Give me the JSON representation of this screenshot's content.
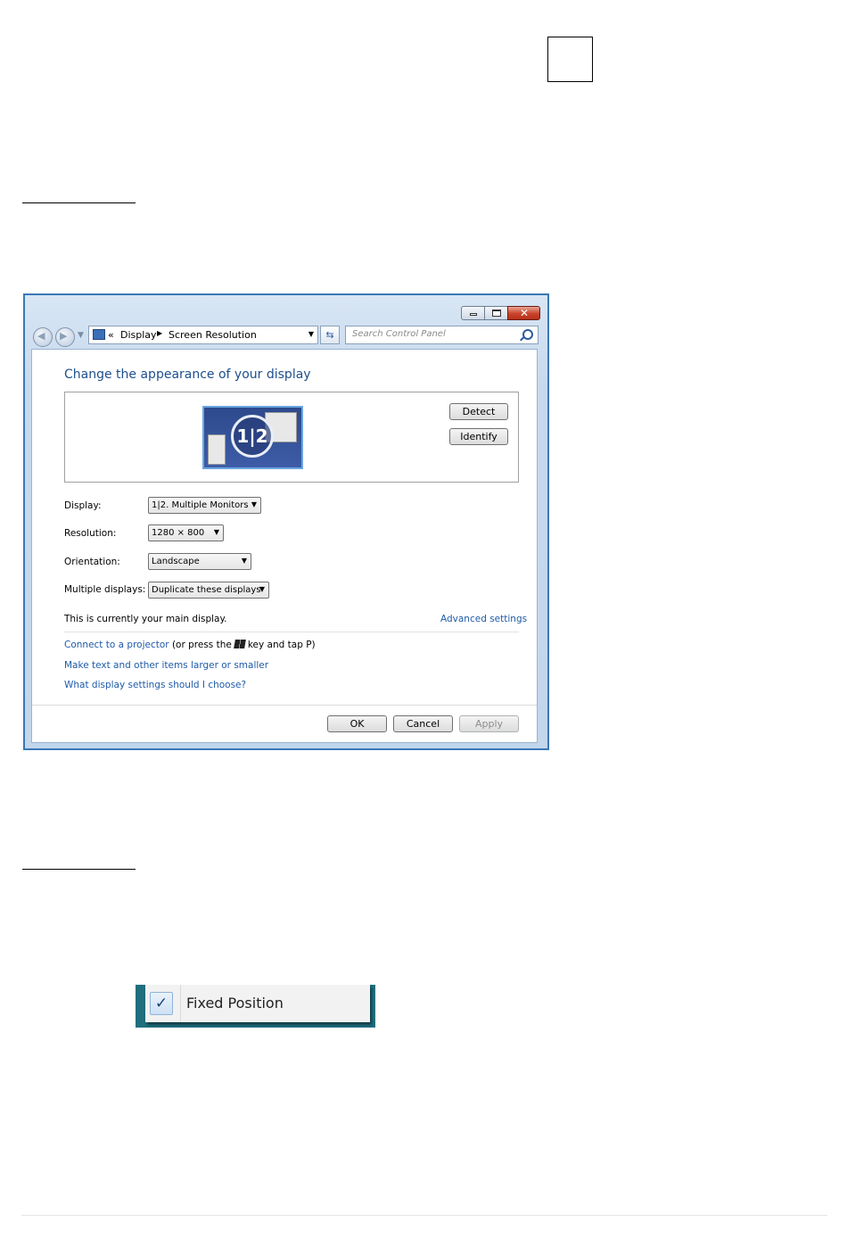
{
  "window": {
    "breadcrumb_prefix": "«",
    "breadcrumb": [
      "Display",
      "Screen Resolution"
    ],
    "search_placeholder": "Search Control Panel",
    "title": "Change the appearance of your display",
    "monitor_badge": "1|2",
    "buttons": {
      "detect": "Detect",
      "identify": "Identify",
      "ok": "OK",
      "cancel": "Cancel",
      "apply": "Apply"
    },
    "fields": {
      "display": {
        "label": "Display:",
        "value": "1|2. Multiple Monitors"
      },
      "resolution": {
        "label": "Resolution:",
        "value": "1280 × 800"
      },
      "orientation": {
        "label": "Orientation:",
        "value": "Landscape"
      },
      "multiple_displays": {
        "label": "Multiple displays:",
        "value": "Duplicate these displays"
      }
    },
    "main_display_note": "This is currently your main display.",
    "advanced_settings": "Advanced settings",
    "projector_link": "Connect to a projector",
    "projector_text_a": "(or press the",
    "projector_text_b": "key and tap P)",
    "larger_link": "Make text and other items larger or smaller",
    "choose_link": "What display settings should I choose?"
  },
  "context_menu": {
    "checked": true,
    "label": "Fixed Position"
  },
  "icons": {
    "check": "✓"
  }
}
